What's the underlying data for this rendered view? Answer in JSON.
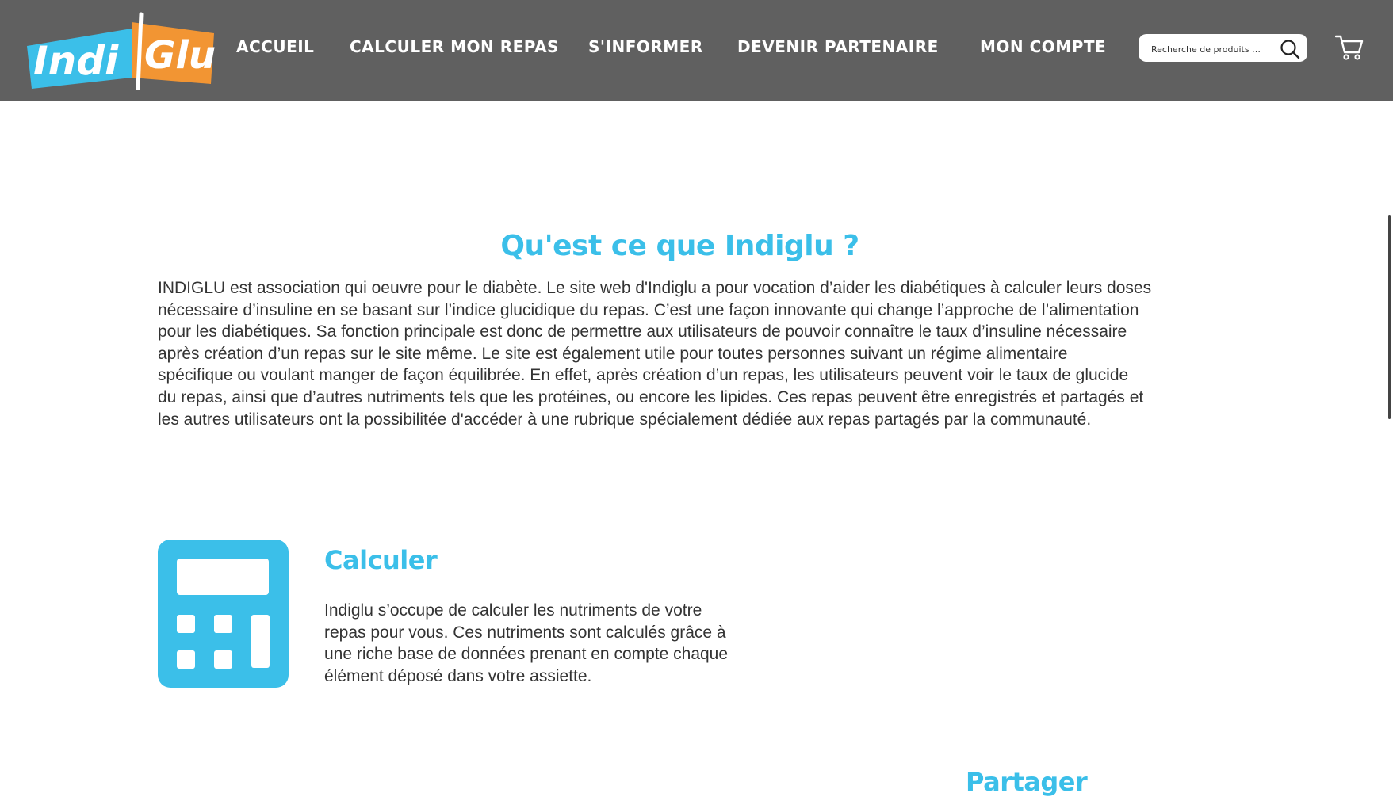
{
  "header": {
    "logo_text": "IndiGlu",
    "nav": [
      {
        "label": "ACCUEIL"
      },
      {
        "label": "CALCULER MON REPAS"
      },
      {
        "label": "S'INFORMER"
      },
      {
        "label": "DEVENIR PARTENAIRE"
      },
      {
        "label": "MON COMPTE"
      }
    ],
    "search": {
      "placeholder": "Recherche de produits …",
      "value": ""
    },
    "icons": {
      "search": "search-icon",
      "cart": "cart-icon"
    }
  },
  "main": {
    "section_title": "Qu'est ce que Indiglu ?",
    "intro_lines": [
      "INDIGLU est association qui oeuvre pour le diabète. Le site web d'Indiglu a pour vocation d’aider les diabétiques à calculer leurs doses",
      "nécessaire d’insuline en se basant sur l’indice glucidique du repas. C’est une façon innovante qui change l’approche de l’alimentation",
      "pour les diabétiques. Sa fonction principale est donc de permettre aux utilisateurs de pouvoir connaître le taux d’insuline nécessaire",
      "après création d’un repas sur le site même. Le site est également utile pour toutes personnes suivant un régime alimentaire",
      "spécifique ou voulant manger de façon équilibrée. En effet, après création d’un repas, les utilisateurs peuvent voir le taux de glucide",
      "du repas, ainsi que d’autres nutriments tels que les protéines, ou encore les lipides. Ces repas peuvent être enregistrés et partagés et",
      "les autres utilisateurs ont la possibilitée d'accéder à une rubrique spécialement dédiée aux repas partagés par la communauté."
    ],
    "features": [
      {
        "icon": "calculator-icon",
        "title": "Calculer",
        "lines": [
          "Indiglu s’occupe de calculer les nutriments de votre",
          "repas pour vous. Ces nutriments sont calculés grâce à",
          "une riche base de données prenant en compte chaque",
          "élément déposé dans votre assiette."
        ]
      },
      {
        "title": "Partager"
      }
    ]
  },
  "colors": {
    "header_bg": "#606060",
    "accent_blue": "#3bbfe9",
    "logo_orange": "#f29533",
    "text": "#333333"
  }
}
